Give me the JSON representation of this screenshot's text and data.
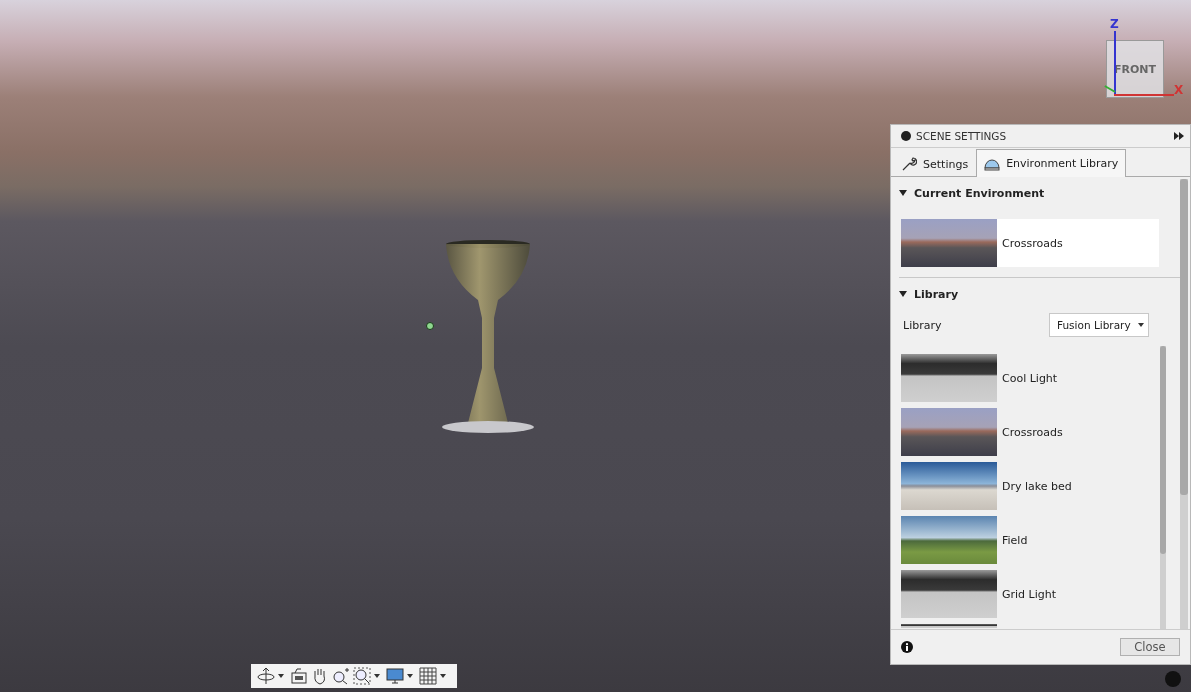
{
  "viewcube": {
    "face": "FRONT",
    "axes": [
      {
        "label": "Z",
        "kind": "z"
      },
      {
        "label": "X",
        "kind": "x"
      }
    ]
  },
  "panel": {
    "title": "SCENE SETTINGS",
    "tabs": [
      {
        "label": "Settings",
        "kind": "wrench",
        "selected": false
      },
      {
        "label": "Environment Library",
        "kind": "dome",
        "selected": true
      }
    ],
    "current": {
      "heading": "Current Environment",
      "expanded": true,
      "name": "Crossroads",
      "kind": "road"
    },
    "library": {
      "heading": "Library",
      "expanded": true,
      "label": "Library",
      "dropdown": "Fusion Library",
      "items": [
        {
          "name": "Cool Light",
          "kind": "studio"
        },
        {
          "name": "Crossroads",
          "kind": "road"
        },
        {
          "name": "Dry lake bed",
          "kind": "lake"
        },
        {
          "name": "Field",
          "kind": "field"
        },
        {
          "name": "Grid Light",
          "kind": "studio"
        }
      ]
    },
    "close": "Close"
  }
}
